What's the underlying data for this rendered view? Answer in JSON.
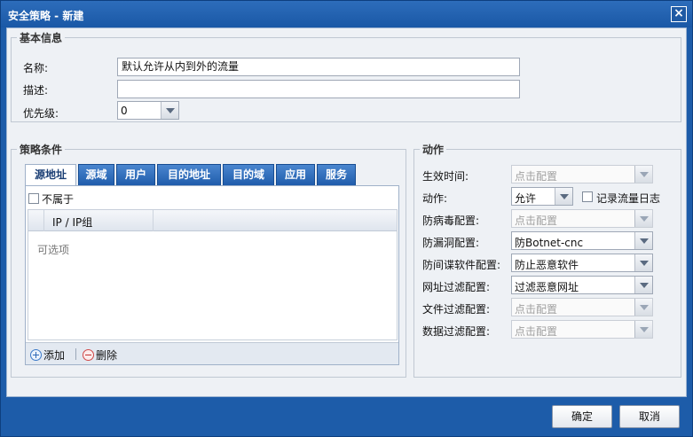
{
  "window": {
    "title": "安全策略 - 新建",
    "close_glyph": "×"
  },
  "basic": {
    "legend": "基本信息",
    "name_label": "名称:",
    "name_value": "默认允许从内到外的流量",
    "desc_label": "描述:",
    "desc_value": "",
    "priority_label": "优先级:",
    "priority_value": "0"
  },
  "conditions": {
    "legend": "策略条件",
    "tabs": [
      "源地址",
      "源域",
      "用户",
      "目的地址",
      "目的域",
      "应用",
      "服务"
    ],
    "active_tab": "源地址",
    "not_belong_label": "不属于",
    "not_belong_checked": false,
    "grid": {
      "column": "IP / IP组",
      "empty_text": "可选项"
    },
    "add_label": "添加",
    "delete_label": "删除"
  },
  "actions": {
    "legend": "动作",
    "rows": [
      {
        "label": "生效时间:",
        "value": "点击配置",
        "placeholder": true
      },
      {
        "label": "动作:",
        "value": "允许",
        "placeholder": false
      },
      {
        "label": "防病毒配置:",
        "value": "点击配置",
        "placeholder": true
      },
      {
        "label": "防漏洞配置:",
        "value": "防Botnet-cnc",
        "placeholder": false
      },
      {
        "label": "防间谍软件配置:",
        "value": "防止恶意软件",
        "placeholder": false
      },
      {
        "label": "网址过滤配置:",
        "value": "过滤恶意网址",
        "placeholder": false
      },
      {
        "label": "文件过滤配置:",
        "value": "点击配置",
        "placeholder": true
      },
      {
        "label": "数据过滤配置:",
        "value": "点击配置",
        "placeholder": true
      }
    ],
    "log_label": "记录流量日志",
    "log_checked": false
  },
  "footer": {
    "ok_label": "确定",
    "cancel_label": "取消"
  },
  "colors": {
    "frame": "#1d5ca9",
    "tab": "#1f5cab",
    "panel": "#eef1f5"
  },
  "icons": {
    "add": "add-circle-icon",
    "delete": "remove-circle-icon",
    "close": "close-icon"
  }
}
